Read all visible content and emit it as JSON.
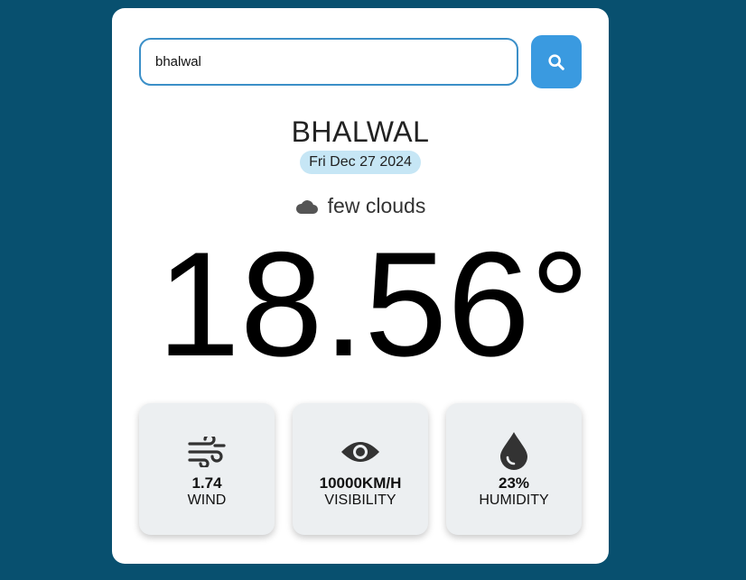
{
  "search": {
    "value": "bhalwal"
  },
  "location": {
    "city": "BHALWAL",
    "date": "Fri Dec 27 2024"
  },
  "weather": {
    "condition_icon": "cloud-icon",
    "description": "few clouds",
    "temperature": "18.56°"
  },
  "stats": [
    {
      "icon": "wind-icon",
      "value": "1.74",
      "label": "WIND"
    },
    {
      "icon": "eye-icon",
      "value": "10000KM/H",
      "label": "VISIBILITY"
    },
    {
      "icon": "droplet-icon",
      "value": "23%",
      "label": "HUMIDITY"
    }
  ],
  "colors": {
    "page_background": "#08506f",
    "card_background": "#ffffff",
    "search_button": "#3a9ae0",
    "input_border": "#3b8fc8",
    "date_pill": "#c6e6f5",
    "stat_card": "#eceff1"
  }
}
